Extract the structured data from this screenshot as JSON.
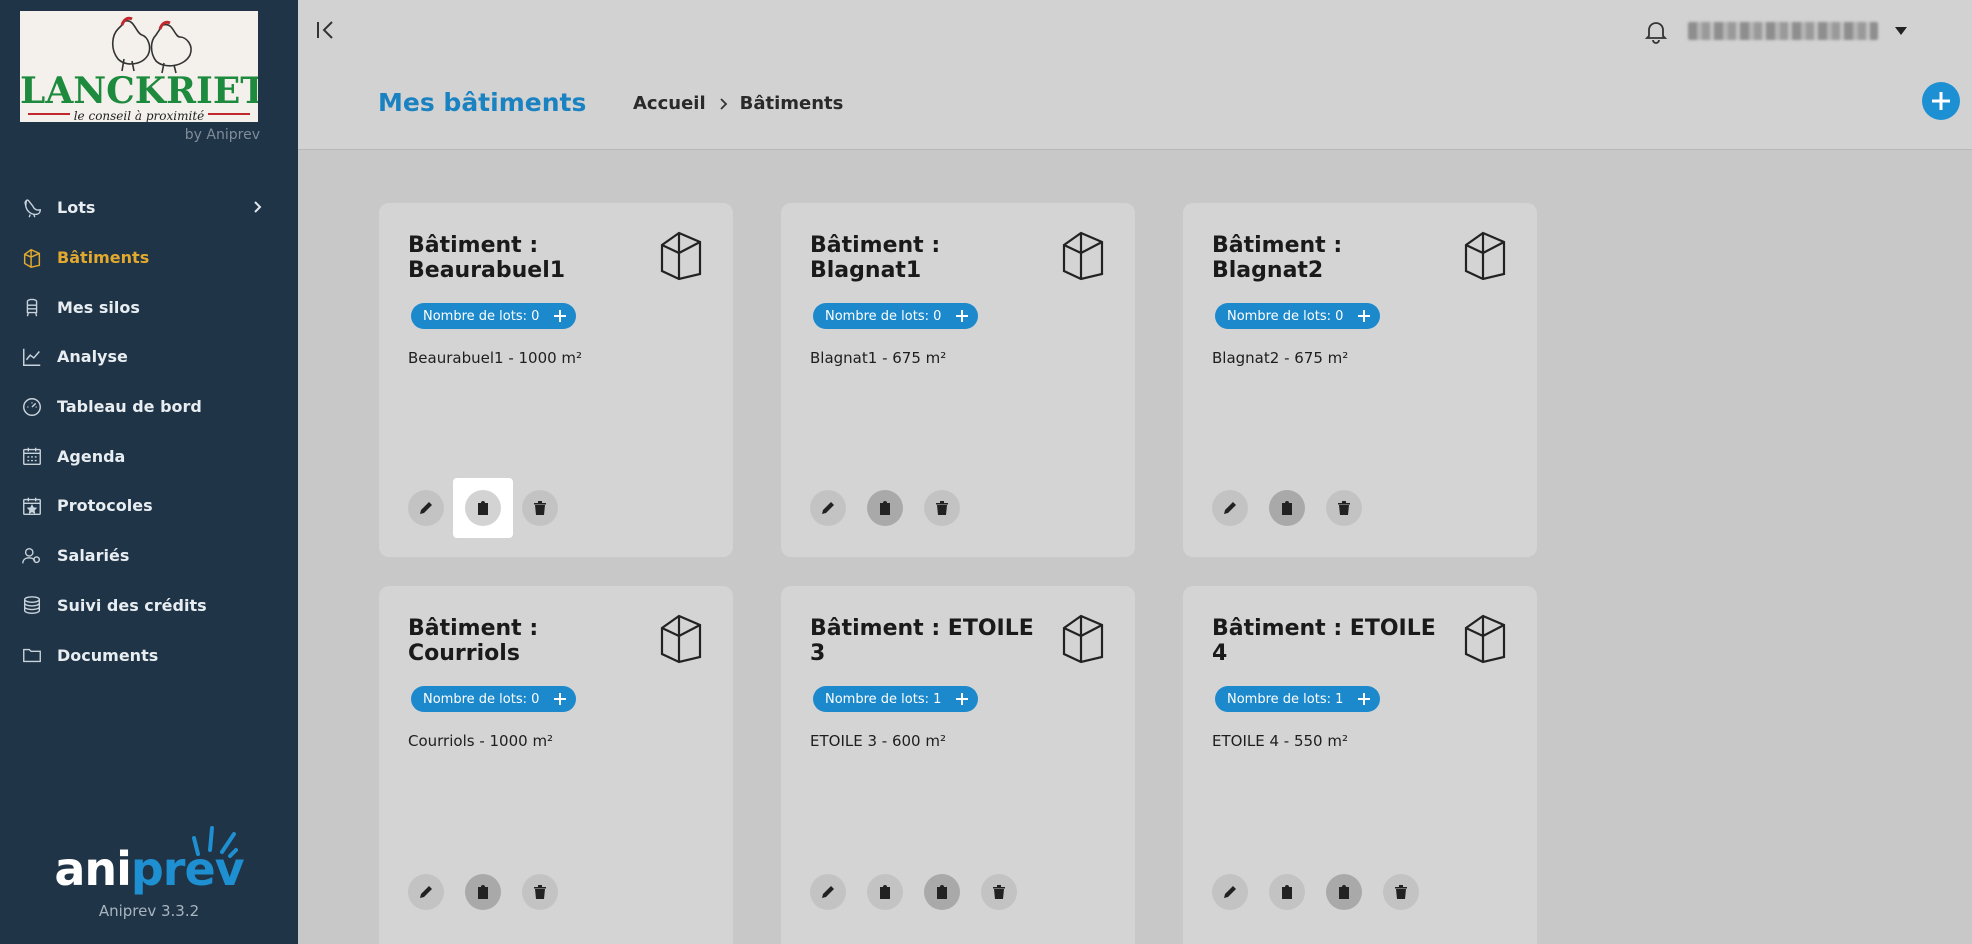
{
  "sidebar": {
    "logo_brand": "LANCKRIET",
    "logo_slogan": "le conseil à proximité",
    "logo_sub": "by Aniprev",
    "items": [
      {
        "label": "Lots",
        "icon": "chicken-icon"
      },
      {
        "label": "Bâtiments",
        "icon": "building-icon"
      },
      {
        "label": "Mes silos",
        "icon": "silo-icon"
      },
      {
        "label": "Analyse",
        "icon": "chart-icon"
      },
      {
        "label": "Tableau de bord",
        "icon": "gauge-icon"
      },
      {
        "label": "Agenda",
        "icon": "calendar-icon"
      },
      {
        "label": "Protocoles",
        "icon": "calendar-star-icon"
      },
      {
        "label": "Salariés",
        "icon": "users-icon"
      },
      {
        "label": "Suivi des crédits",
        "icon": "coins-icon"
      },
      {
        "label": "Documents",
        "icon": "folder-icon"
      }
    ],
    "active_item": "Bâtiments",
    "footer_brand_a": "ani",
    "footer_brand_b": "prev",
    "version": "Aniprev 3.3.2"
  },
  "header": {
    "page_title": "Mes bâtiments",
    "breadcrumb": [
      "Accueil",
      "Bâtiments"
    ],
    "username": "(masqué)"
  },
  "colors": {
    "sidebar_bg": "#1f3447",
    "accent_blue": "#1b89cc",
    "active_nav": "#e2a92e",
    "card_bg": "#d4d4d4"
  },
  "cards": [
    {
      "title": "Bâtiment : Beaurabuel1",
      "lots": "Nombre de lots: 0",
      "desc": "Beaurabuel1 - 1000 m²"
    },
    {
      "title": "Bâtiment : Blagnat1",
      "lots": "Nombre de lots: 0",
      "desc": "Blagnat1 - 675 m²"
    },
    {
      "title": "Bâtiment : Blagnat2",
      "lots": "Nombre de lots: 0",
      "desc": "Blagnat2 - 675 m²"
    },
    {
      "title": "Bâtiment : Courriols",
      "lots": "Nombre de lots: 0",
      "desc": "Courriols - 1000 m²"
    },
    {
      "title": "Bâtiment : ETOILE 3",
      "lots": "Nombre de lots: 1",
      "desc": "ETOILE 3 - 600 m²"
    },
    {
      "title": "Bâtiment : ETOILE 4",
      "lots": "Nombre de lots: 1",
      "desc": "ETOILE 4 - 550 m²"
    }
  ]
}
